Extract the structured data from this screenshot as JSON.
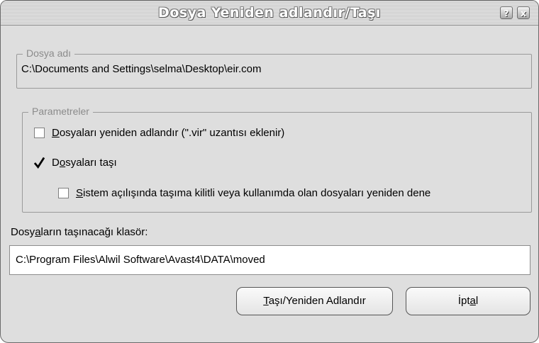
{
  "window": {
    "title": "Dosya Yeniden adlandır/Taşı",
    "help_glyph": "?",
    "close_glyph": "x"
  },
  "file_group": {
    "legend": "Dosya adı",
    "path": "C:\\Documents and Settings\\selma\\Desktop\\eir.com"
  },
  "params": {
    "legend": "Parametreler",
    "rename": {
      "mnemonic": "D",
      "rest": "osyaları yeniden adlandır (\".vir\" uzantısı eklenir)",
      "checked": false
    },
    "move": {
      "before": "D",
      "mnemonic": "o",
      "rest": "syaları taşı",
      "checked": true
    },
    "retry": {
      "mnemonic": "S",
      "rest": "istem açılışında taşıma kilitli veya kullanımda olan dosyaları yeniden dene",
      "checked": false
    }
  },
  "folder": {
    "label_before": "Dosy",
    "label_mnemonic": "a",
    "label_after": "ların taşınacağı klasör:",
    "value": "C:\\Program Files\\Alwil Software\\Avast4\\DATA\\moved"
  },
  "buttons": {
    "move_rename": {
      "mnemonic": "T",
      "rest": "aşı/Yeniden Adlandır"
    },
    "cancel": {
      "before": "İpt",
      "mnemonic": "a",
      "after": "l"
    }
  }
}
